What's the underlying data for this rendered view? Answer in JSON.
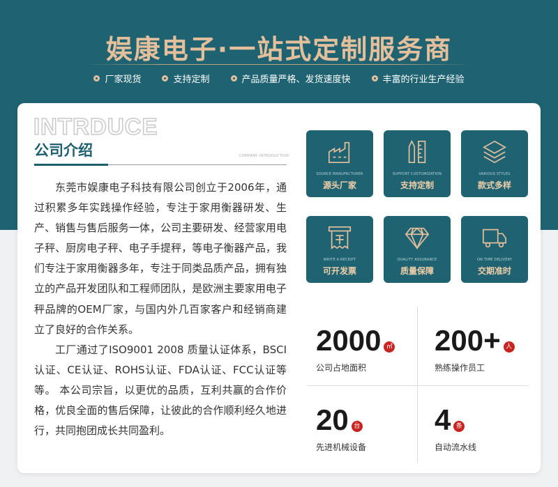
{
  "header": {
    "title_part1": "娱康电子",
    "title_dot": "·",
    "title_part2": "一站式定制服务商",
    "tags": [
      "厂家现货",
      "支持定制",
      "产品质量严格、发货速度快",
      "丰富的行业生产经验"
    ]
  },
  "intro": {
    "heading_en": "INTRDUCE",
    "heading_cn": "公司介绍",
    "heading_small": "COMPANY INTRODUCTION",
    "paragraph1": "东莞市娱康电子科技有限公司创立于2006年，通过积累多年实践操作经验，专注于家用衡器研发、生产、销售与售后服务一体，公司主要研发、经营家用电子秤、厨房电子秤、电子手提秤，等电子衡器产品，我们专注于家用衡器多年，专注于同类品质产品，拥有独立的产品开发团队和工程师团队，是欧洲主要家用电子秤品牌的OEM厂家，与国内外几百家客户和经销商建立了良好的合作关系。",
    "paragraph2": "工厂通过了ISO9001 2008 质量认证体系，BSCI认证、CE认证、ROHS认证、FDA认证、FCC认证等等。 本公司宗旨，以更优的品质，互利共赢的合作价格，优良全面的售后保障，让彼此的合作顺利经久地进行，共同抱团成长共同盈利。"
  },
  "features": [
    {
      "en": "SOURCE MANUFACTURER",
      "cn": "源头厂家",
      "icon": "factory-icon"
    },
    {
      "en": "SUPPORT CUSTOMIZATION",
      "cn": "支持定制",
      "icon": "ruler-pencil-icon"
    },
    {
      "en": "VARIOUS STYLES",
      "cn": "款式多样",
      "icon": "layers-icon"
    },
    {
      "en": "WRITE A RECEIPT",
      "cn": "可开发票",
      "icon": "receipt-icon"
    },
    {
      "en": "QUALITY ASSURANCE",
      "cn": "质量保障",
      "icon": "diamond-icon"
    },
    {
      "en": "ON TIME DELIVERY",
      "cn": "交期准时",
      "icon": "truck-icon"
    }
  ],
  "stats": [
    {
      "value": "2000",
      "unit": "㎡",
      "label": "公司占地面积"
    },
    {
      "value": "200+",
      "unit": "人",
      "label": "熟练操作员工"
    },
    {
      "value": "20",
      "unit": "台",
      "label": "先进机械设备"
    },
    {
      "value": "4",
      "unit": "条",
      "label": "自动流水线"
    }
  ],
  "colors": {
    "teal": "#1f6373",
    "gold": "#e3bf9c",
    "red": "#c8231f"
  }
}
